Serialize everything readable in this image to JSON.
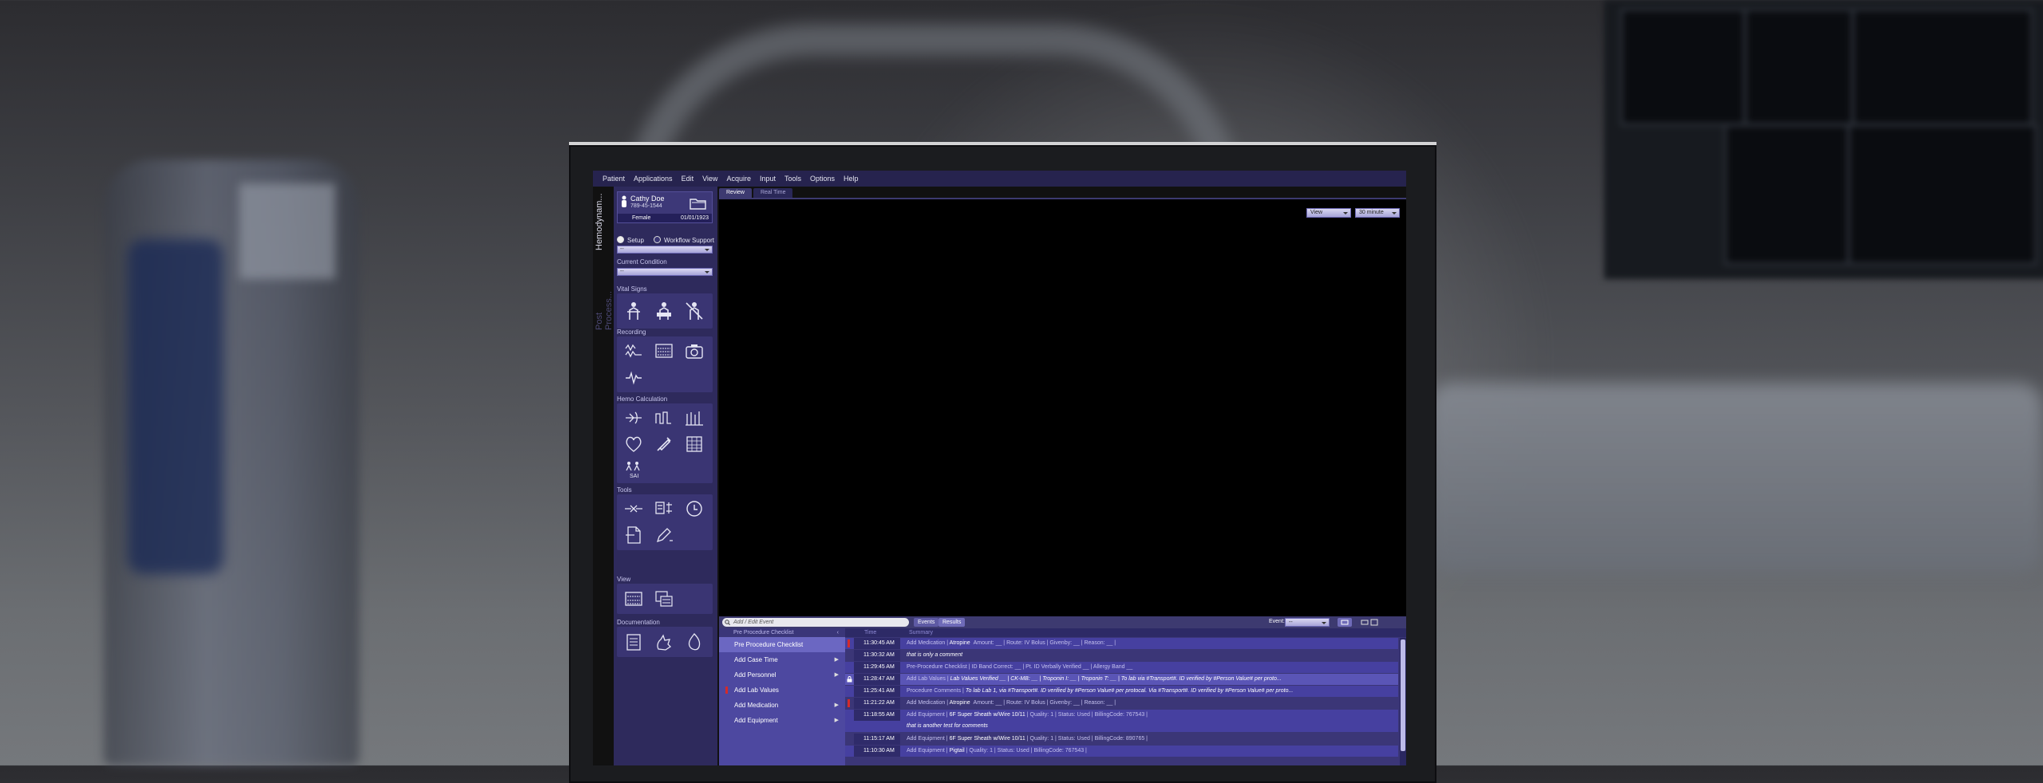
{
  "menu": [
    "Patient",
    "Applications",
    "Edit",
    "View",
    "Acquire",
    "Input",
    "Tools",
    "Options",
    "Help"
  ],
  "vertical_tabs": [
    "Hemodynam...",
    "Post Process..."
  ],
  "patient": {
    "name": "Cathy Doe",
    "id": "789-45-1544",
    "sex": "Female",
    "dob": "01/01/1923"
  },
  "radios": {
    "setup": "Setup",
    "workflow": "Workflow Support"
  },
  "current_condition": {
    "label": "Current Condition",
    "value": "--"
  },
  "setup_dropdown": "--",
  "sections": {
    "vital": "Vital Signs",
    "recording": "Recording",
    "hemo": "Hemo Calculation",
    "tools": "Tools",
    "view": "View",
    "documentation": "Documentation"
  },
  "hemo_sai_label": "SAI",
  "tabs": [
    "Review",
    "Real Time"
  ],
  "view_controls": {
    "view": "View",
    "minutes": "30 minute"
  },
  "event_bar": {
    "search_placeholder": "Add / Edit Event",
    "btn_events": "Events",
    "btn_results": "Results",
    "event_label": "Event:",
    "event_value": "--"
  },
  "checklist": {
    "header": "Pre Procedure Checklist",
    "items": [
      {
        "label": "Pre Procedure Checklist"
      },
      {
        "label": "Add Case Time"
      },
      {
        "label": "Add Personnel"
      },
      {
        "label": "Add Lab Values"
      },
      {
        "label": "Add Medication"
      },
      {
        "label": "Add Equipment"
      }
    ]
  },
  "events_header": {
    "time": "Time",
    "summary": "Summary"
  },
  "events": [
    {
      "time": "11:30:45 AM",
      "kind": "Add Medication",
      "text": "Atropine",
      "rest": "Amount: __ | Route: IV Bolus | Givenby: __ | Reason: __ |"
    },
    {
      "time": "11:30:32 AM",
      "kind": "",
      "text": "that is only a comment",
      "rest": ""
    },
    {
      "time": "11:29:45 AM",
      "kind": "Pre-Procedure Checklist |",
      "text": "",
      "rest": "ID Band Correct: __ | Pt. ID Verbally Verified __ | Allergy Band __"
    },
    {
      "time": "11:28:47 AM",
      "kind": "Add Lab Values |",
      "text": "",
      "rest": "Lab Values Verified __ | CK-MB: __ | Troponin I: __ | Troponin T: __ | To lab via #Transport#. ID verified by #Person Value# per proto..."
    },
    {
      "time": "11:25:41 AM",
      "kind": "Procedure Comments |",
      "text": "",
      "rest": "To lab Lab 1, via #Transport#. ID verified by #Person Value# per protocal. Via #Transport#. ID verified by #Person Value# per proto..."
    },
    {
      "time": "11:21:22 AM",
      "kind": "Add Medication |",
      "text": "Atropine",
      "rest": "Amount: __ | Route: IV Bolus | Givenby: __ | Reason: __ |"
    },
    {
      "time": "11:18:55 AM",
      "kind": "Add Equipment |",
      "text": "6F Super Sheath w/Wire 10/11",
      "rest": "| Quality: 1 | Status: Used | BillingCode: 767543 |"
    },
    {
      "time": "",
      "kind": "",
      "text": "that is another test for comments",
      "rest": ""
    },
    {
      "time": "11:15:17 AM",
      "kind": "Add Equipment |",
      "text": "6F Super Sheath w/Wire 10/11",
      "rest": "| Quality: 1 | Status: Used | BillingCode: 890765 |"
    },
    {
      "time": "11:10:30 AM",
      "kind": "Add Equipment |",
      "text": "Pigtail",
      "rest": "| Quality: 1 | Status: Used | BillingCode: 767543 |"
    }
  ],
  "colors": {
    "panel": "#2e2a5c",
    "accent": "#5e5aa4",
    "flag": "#d32b2b"
  }
}
